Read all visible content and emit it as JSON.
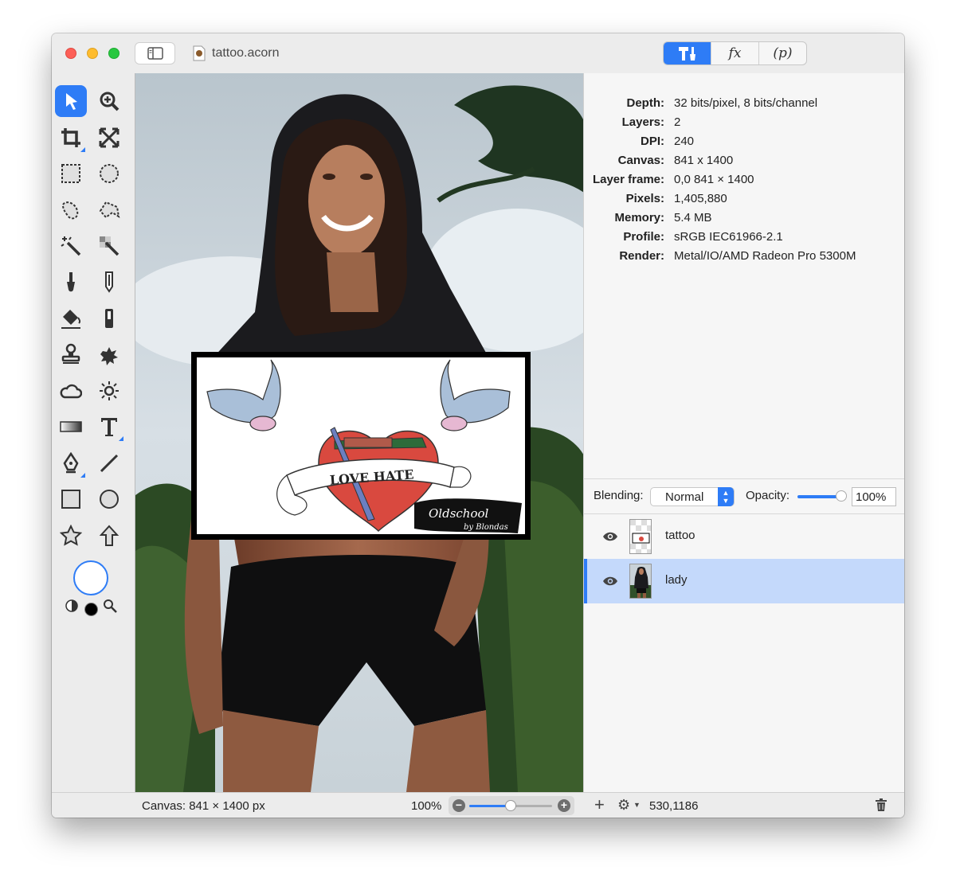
{
  "window": {
    "title": "tattoo.acorn"
  },
  "mode_tabs": [
    {
      "label": "",
      "icon": "tools-icon",
      "active": true
    },
    {
      "label": "fx",
      "icon": "fx-icon",
      "active": false
    },
    {
      "label": "(p)",
      "icon": "plugin-icon",
      "active": false
    }
  ],
  "tools": [
    "pointer-tool-icon",
    "zoom-tool-icon",
    "crop-tool-icon",
    "transform-tool-icon",
    "rect-select-icon",
    "ellipse-select-icon",
    "lasso-icon",
    "polygon-lasso-icon",
    "magic-wand-icon",
    "color-wand-icon",
    "brush-icon",
    "pencil-icon",
    "paint-bucket-icon",
    "gradient-fill-icon",
    "clone-stamp-icon",
    "splatter-icon",
    "smudge-cloud-icon",
    "sun-icon",
    "gradient-icon",
    "text-tool-icon",
    "pen-tool-icon",
    "line-tool-icon",
    "rectangle-shape-icon",
    "oval-shape-icon",
    "star-shape-icon",
    "arrow-shape-icon"
  ],
  "colors": {
    "accent": "#2e7cf6",
    "foreground": "#ffffff",
    "background": "#000000"
  },
  "info": [
    {
      "key": "Depth:",
      "value": "32 bits/pixel, 8 bits/channel"
    },
    {
      "key": "Layers:",
      "value": "2"
    },
    {
      "key": "DPI:",
      "value": "240"
    },
    {
      "key": "Canvas:",
      "value": "841 x 1400"
    },
    {
      "key": "Layer frame:",
      "value": "0,0 841 × 1400"
    },
    {
      "key": "Pixels:",
      "value": "1,405,880"
    },
    {
      "key": "Memory:",
      "value": "5.4 MB"
    },
    {
      "key": "Profile:",
      "value": "sRGB IEC61966-2.1"
    },
    {
      "key": "Render:",
      "value": "Metal/IO/AMD Radeon Pro 5300M"
    }
  ],
  "blending": {
    "label": "Blending:",
    "value": "Normal"
  },
  "opacity": {
    "label": "Opacity:",
    "value": "100%",
    "level": 1.0
  },
  "layers": [
    {
      "name": "tattoo",
      "selected": false,
      "visible": true
    },
    {
      "name": "lady",
      "selected": true,
      "visible": true
    }
  ],
  "status": {
    "canvas_size": "Canvas: 841 × 1400 px",
    "zoom": "100%",
    "coords": "530,1186"
  },
  "artwork": {
    "banner_text": "LOVE HATE",
    "logo_text": "Oldschool",
    "logo_sub": "by Blondas"
  }
}
